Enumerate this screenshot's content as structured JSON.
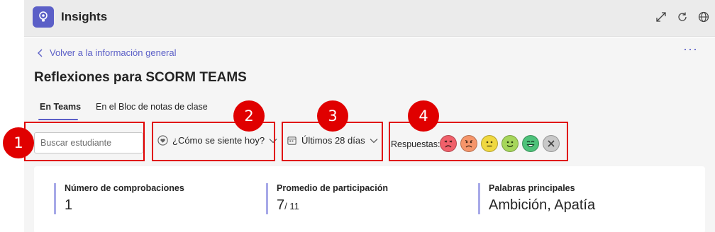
{
  "app": {
    "title": "Insights"
  },
  "header": {
    "icons": [
      "expand-icon",
      "refresh-icon",
      "globe-icon"
    ]
  },
  "nav": {
    "back_label": "Volver a la información general",
    "more_label": "···"
  },
  "page": {
    "title": "Reflexiones para SCORM TEAMS"
  },
  "tabs": [
    {
      "label": "En Teams",
      "active": true
    },
    {
      "label": "En el Bloc de notas de clase",
      "active": false
    }
  ],
  "filters": {
    "search_placeholder": "Buscar estudiante",
    "question_label": "¿Cómo se siente hoy?",
    "period_label": "Últimos 28 días",
    "responses_label": "Respuestas:"
  },
  "emojis": [
    {
      "name": "very-unhappy-emoji",
      "color": "#f0606a"
    },
    {
      "name": "unhappy-emoji",
      "color": "#f5956a"
    },
    {
      "name": "neutral-emoji",
      "color": "#f0d840"
    },
    {
      "name": "happy-emoji",
      "color": "#a6d65a"
    },
    {
      "name": "very-happy-emoji",
      "color": "#4ec27a"
    },
    {
      "name": "clear-emoji",
      "color": "#c8c8c8"
    }
  ],
  "callouts": [
    "1",
    "2",
    "3",
    "4"
  ],
  "stats": [
    {
      "label": "Número de comprobaciones",
      "value": "1"
    },
    {
      "label": "Promedio de participación",
      "value": "7",
      "value_suffix": "/ 11"
    },
    {
      "label": "Palabras principales",
      "value": "Ambición, Apatía"
    }
  ],
  "colors": {
    "accent": "#5b5fc7",
    "callout": "#e00000",
    "stat_bar": "#a7a9e8"
  }
}
